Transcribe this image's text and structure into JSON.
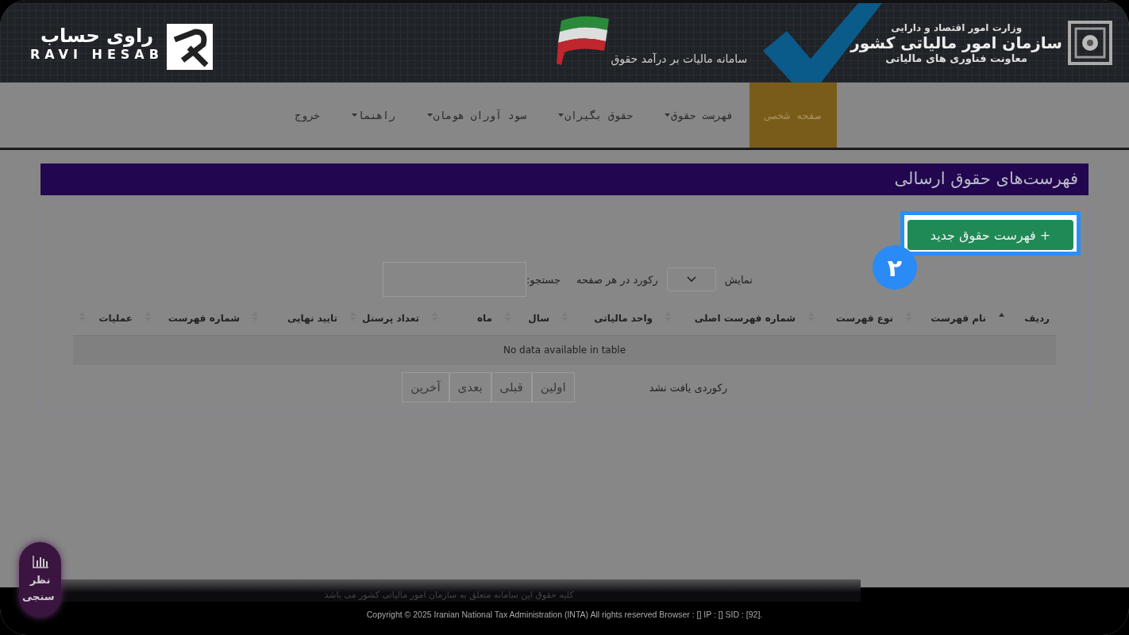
{
  "header": {
    "brand_fa": "راوی حساب",
    "brand_en": "RAVI HESAB",
    "system_title": "سامانه مالیات بر درآمد حقوق",
    "ministry": "وزارت امور اقتصاد و دارایی",
    "org": "سازمان امور مالیاتی کشور",
    "deputy": "معاونت فناوری های مالیاتی"
  },
  "nav": [
    {
      "label": "صفحه شخصی",
      "selected": true,
      "dropdown": false
    },
    {
      "label": "فهرست حقوق",
      "selected": false,
      "dropdown": true
    },
    {
      "label": "حقوق بگیران",
      "selected": false,
      "dropdown": true
    },
    {
      "label": "سود آوران هومان",
      "selected": false,
      "dropdown": true
    },
    {
      "label": "راهنما",
      "selected": false,
      "dropdown": true
    },
    {
      "label": "خروج",
      "selected": false,
      "dropdown": false
    }
  ],
  "page_title": "فهرست‌های حقوق ارسالی",
  "new_button": {
    "label": "+ فهرست حقوق جدید",
    "highlighted": true
  },
  "step_badge": "۲",
  "length_control": {
    "before": "نمایش",
    "after": "رکورد در هر صفحه"
  },
  "search": {
    "label": "جستجو:"
  },
  "table": {
    "columns": [
      {
        "label": "ردیف",
        "sorted": true
      },
      {
        "label": "نام فهرست",
        "sorted": false
      },
      {
        "label": "نوع فهرست",
        "sorted": false
      },
      {
        "label": "شماره فهرست اصلی",
        "sorted": false
      },
      {
        "label": "واحد مالیاتی",
        "sorted": false
      },
      {
        "label": "سال",
        "sorted": false
      },
      {
        "label": "ماه",
        "sorted": false
      },
      {
        "label": "تعداد پرسنل",
        "sorted": false
      },
      {
        "label": "تایید نهایی",
        "sorted": false
      },
      {
        "label": "شماره فهرست",
        "sorted": false
      },
      {
        "label": "عملیات",
        "sorted": false
      }
    ],
    "empty_message": "No data available in table"
  },
  "info": "رکوردی یافت نشد",
  "pagination": [
    "اولین",
    "قبلی",
    "بعدی",
    "آخرین"
  ],
  "survey": {
    "label": "نظر سنجی"
  },
  "footer": {
    "rights": "کلیه حقوق این سامانه متعلق به سازمان امور مالیاتی کشور می باشد",
    "copyright": "Copyright © 2025 Iranian National Tax Administration (INTA) All rights reserved Browser : [] IP : [] SID : [92]."
  }
}
